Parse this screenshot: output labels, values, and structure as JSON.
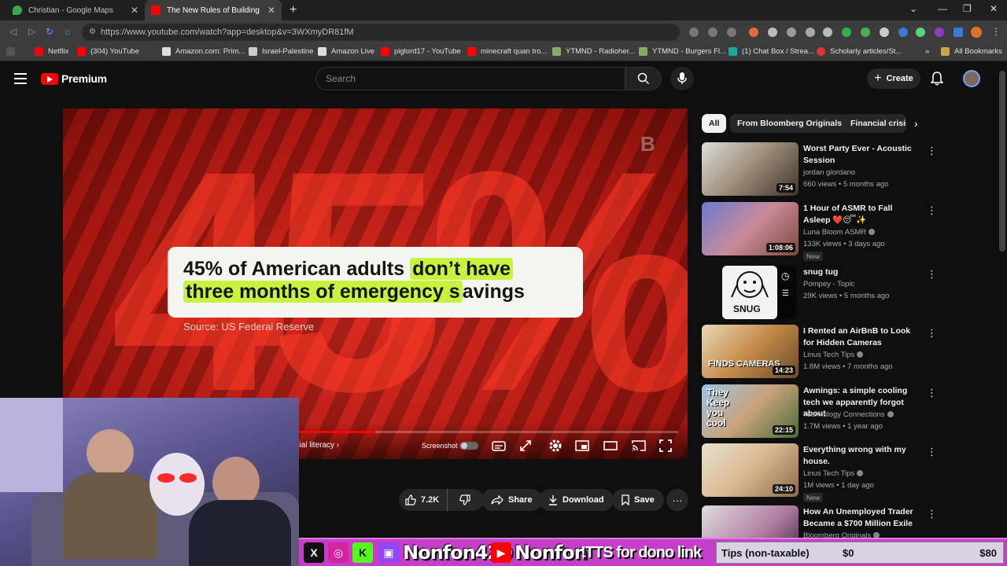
{
  "browser": {
    "tabs": [
      {
        "title": "Christian - Google Maps",
        "active": false
      },
      {
        "title": "The New Rules of Building Wealth",
        "active": true
      }
    ],
    "url": "https://www.youtube.com/watch?app=desktop&v=3WXmyDR81fM",
    "bookmarks": [
      "Netflix",
      "(304) YouTube",
      "Amazon.com: Prim...",
      "Israel-Palestine",
      "Amazon Live",
      "piglord17 - YouTube",
      "minecraft quan tro...",
      "YTMND - Radioher...",
      "YTMND - Burgers Fl...",
      "(1) Chat Box / Strea...",
      "Scholarly articles/St..."
    ],
    "all_bookmarks": "All Bookmarks"
  },
  "youtube": {
    "brand": "Premium",
    "search_placeholder": "Search",
    "create_label": "Create"
  },
  "video": {
    "big_number": "45%",
    "stat_line1_plain": "45% of American adults",
    "stat_line1_hl": "don’t have",
    "stat_line2_hl": "three months of emergency s",
    "stat_line2_plain": "avings",
    "source": "Source: US Federal Reserve",
    "chapter": "ncial literacy",
    "screenshot_label": "Screenshot",
    "progress": 0.5
  },
  "actions": {
    "likes": "7.2K",
    "share": "Share",
    "download": "Download",
    "save": "Save"
  },
  "chips": [
    "All",
    "From Bloomberg Originals",
    "Financial crisis"
  ],
  "recommendations": [
    {
      "title": "Worst Party Ever - Acoustic Session",
      "channel": "jordan giordano",
      "verified": false,
      "meta": "660 views • 5 months ago",
      "duration": "7:54",
      "badge": ""
    },
    {
      "title": "1 Hour of ASMR to Fall Asleep ❤️😴✨",
      "channel": "Luna Bloom ASMR",
      "verified": true,
      "meta": "133K views • 3 days ago",
      "duration": "1:08:06",
      "badge": "New"
    },
    {
      "title": "snug tug",
      "channel": "Pompey - Topic",
      "verified": false,
      "meta": "29K views • 5 months ago",
      "duration": "",
      "badge": ""
    },
    {
      "title": "I Rented an AirBnB to Look for Hidden Cameras",
      "channel": "Linus Tech Tips",
      "verified": true,
      "meta": "1.8M views • 7 months ago",
      "duration": "14:23",
      "badge": ""
    },
    {
      "title": "Awnings: a simple cooling tech we apparently forgot about",
      "channel": "Technology Connections",
      "verified": true,
      "meta": "1.7M views • 1 year ago",
      "duration": "22:15",
      "badge": ""
    },
    {
      "title": "Everything wrong with my house.",
      "channel": "Linus Tech Tips",
      "verified": true,
      "meta": "1M views • 1 day ago",
      "duration": "24:10",
      "badge": "New"
    },
    {
      "title": "How An Unemployed Trader Became a $700 Million Exile",
      "channel": "Bloomberg Originals",
      "verified": true,
      "meta": "",
      "duration": "",
      "badge": ""
    }
  ],
  "thumb_text": {
    "snug": "SNUG",
    "cameras": "FINDS CAMERAS",
    "awning": "They Keep you cool"
  },
  "stream": {
    "name1": "Nonfon420",
    "name2": "Nonfon",
    "tts": "!TTS for dono link",
    "tips_label": "Tips (non-taxable)",
    "tips_a": "$0",
    "tips_b": "$80"
  },
  "colors": {
    "youtube_red": "#ff0000",
    "highlight": "#c9f23e",
    "stream_bar": "#c43fc8"
  }
}
